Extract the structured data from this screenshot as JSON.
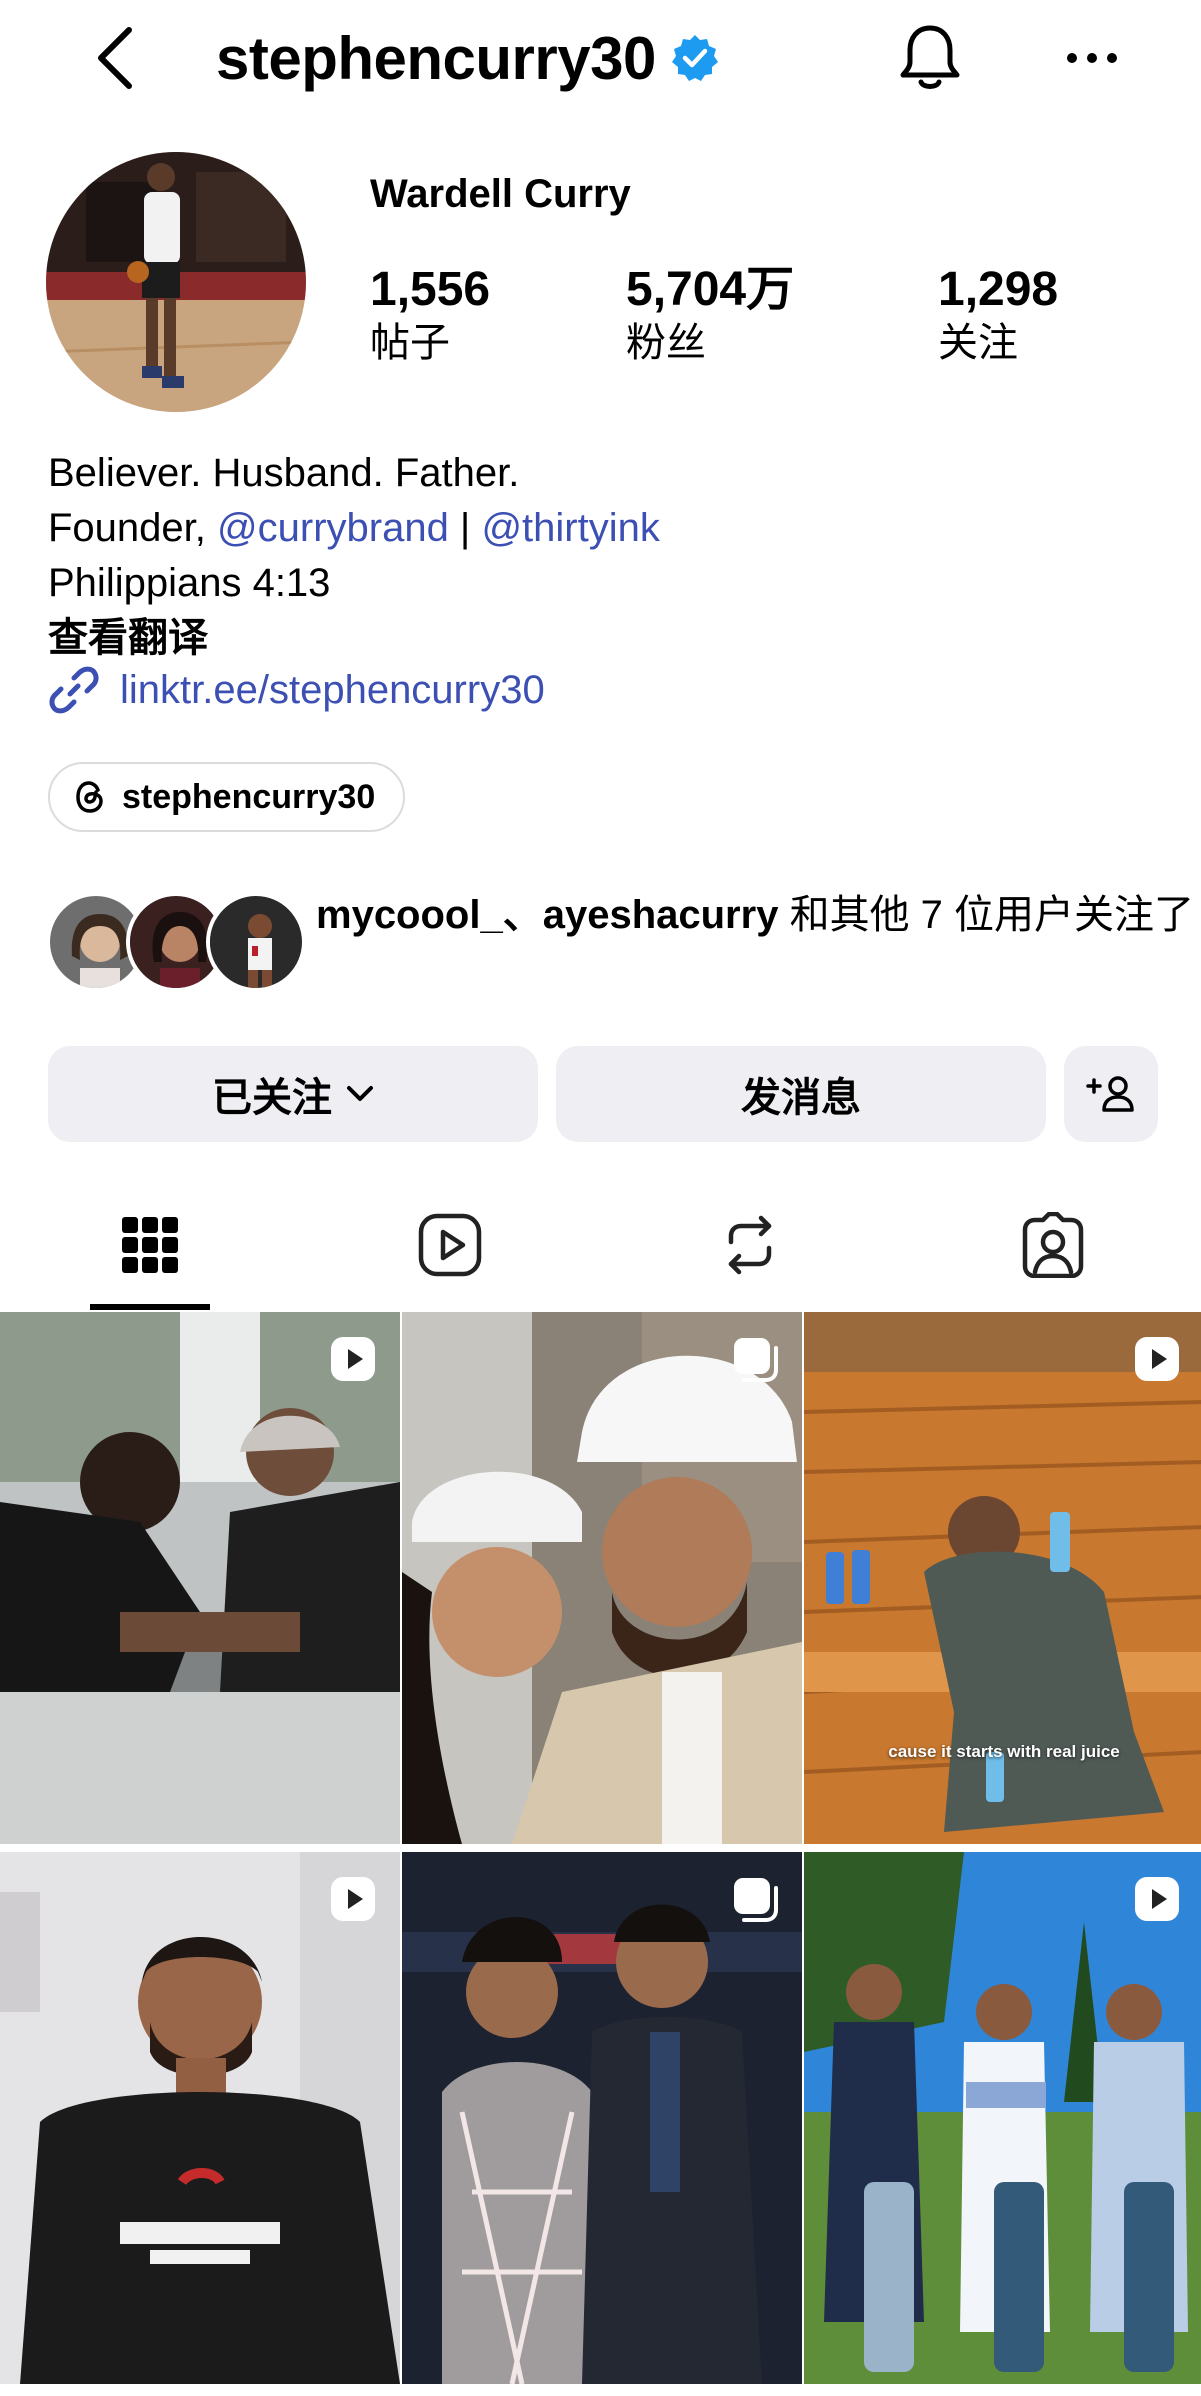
{
  "header": {
    "username": "stephencurry30",
    "icons": {
      "back": "chevron-left-icon",
      "verified": "verified-badge-icon",
      "notifications": "bell-icon",
      "more": "more-dots-icon"
    }
  },
  "profile": {
    "display_name": "Wardell Curry",
    "stats": [
      {
        "value": "1,556",
        "label": "帖子"
      },
      {
        "value": "5,704万",
        "label": "粉丝"
      },
      {
        "value": "1,298",
        "label": "关注"
      }
    ]
  },
  "bio": {
    "line1": "Believer. Husband. Father.",
    "founder_prefix": "Founder, ",
    "mention1": "@currybrand",
    "separator": " | ",
    "mention2": "@thirtyink",
    "line3": "Philippians 4:13",
    "translate": "查看翻译",
    "link": "linktr.ee/stephencurry30"
  },
  "threads": {
    "label": "stephencurry30"
  },
  "followed_by": {
    "names": "mycoool_、ayeshacurry",
    "suffix": " 和其他 7 位用户关注了"
  },
  "actions": {
    "following": "已关注",
    "message": "发消息",
    "add_user_icon": "add-person-icon"
  },
  "tabs": [
    "posts-grid-icon",
    "reels-icon",
    "reposts-icon",
    "tagged-icon"
  ],
  "grid": {
    "captions": {
      "post3": "cause it starts with real juice"
    },
    "badges": [
      "reel",
      "carousel",
      "reel",
      "reel",
      "carousel",
      "reel"
    ]
  },
  "colors": {
    "link": "#3c4fb3",
    "verified": "#1d9bf0",
    "button_bg": "#efeff3"
  }
}
